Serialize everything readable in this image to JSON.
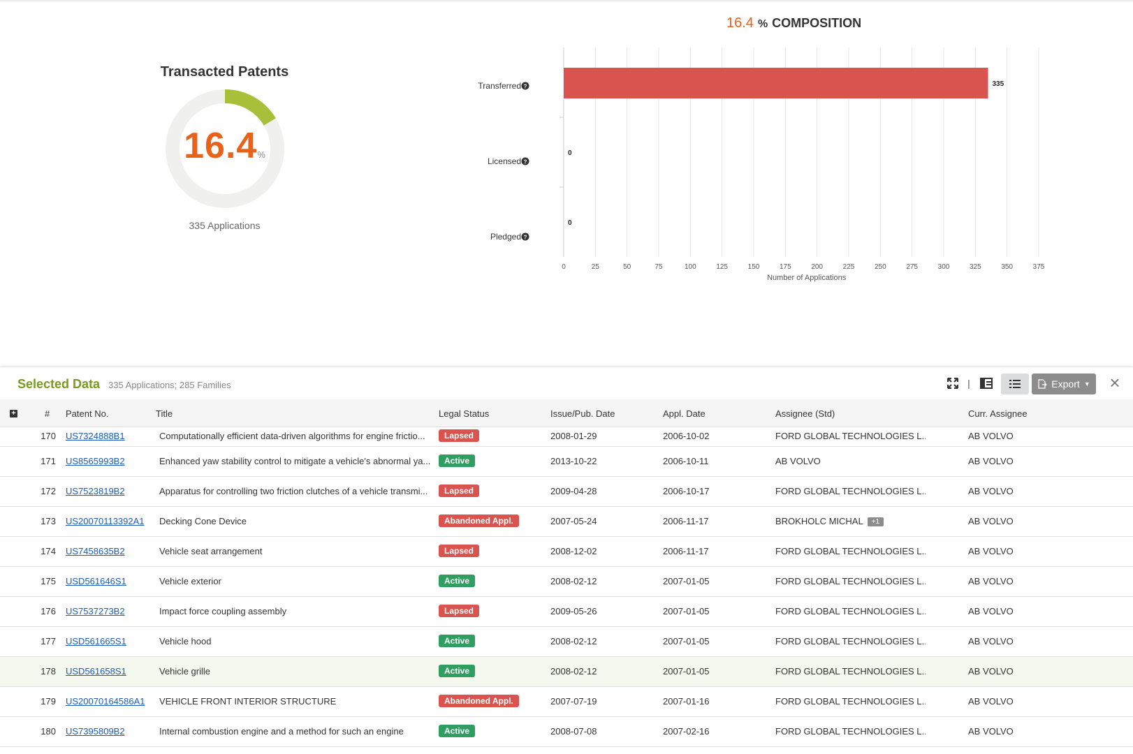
{
  "donut": {
    "title": "Transacted Patents",
    "value": "16.4",
    "unit": "%",
    "fraction": 0.164,
    "subtitle": "335 Applications",
    "colors": {
      "fill": "#a8bf3a",
      "track": "#f0f0ee",
      "value": "#e8621a"
    }
  },
  "composition": {
    "pct": "16.4",
    "pct_sign": "%",
    "title": "COMPOSITION"
  },
  "chart_data": {
    "type": "bar",
    "orientation": "horizontal",
    "categories": [
      "Transferred",
      "Licensed",
      "Pledged"
    ],
    "values": [
      335,
      0,
      0
    ],
    "value_labels": [
      "335",
      "0",
      "0"
    ],
    "xlabel": "Number of Applications",
    "xlim": [
      0,
      375
    ],
    "xticks": [
      "0",
      "25",
      "50",
      "75",
      "100",
      "125",
      "150",
      "175",
      "200",
      "225",
      "250",
      "275",
      "300",
      "325",
      "350",
      "375"
    ],
    "grid": true,
    "bar_color": "#d9534f",
    "help_icon": "question-circle-icon"
  },
  "panel": {
    "title": "Selected Data",
    "summary": "335 Applications; 285 Families",
    "separator": "|",
    "export_label": "Export",
    "close_glyph": "×"
  },
  "columns": {
    "num": "#",
    "patent": "Patent No.",
    "title": "Title",
    "status": "Legal Status",
    "issue": "Issue/Pub. Date",
    "appl": "Appl. Date",
    "assignee": "Assignee (Std)",
    "current": "Curr. Assignee"
  },
  "rows": [
    {
      "num": "170",
      "patent": "US7324888B1",
      "title": "Computationally efficient data-driven algorithms for engine frictio...",
      "status": "Lapsed",
      "status_type": "lapsed",
      "issue": "2008-01-29",
      "appl": "2006-10-02",
      "assignee": "FORD GLOBAL TECHNOLOGIES L...",
      "extra": "",
      "current": "AB VOLVO"
    },
    {
      "num": "171",
      "patent": "US8565993B2",
      "title": "Enhanced yaw stability control to mitigate a vehicle's abnormal ya...",
      "status": "Active",
      "status_type": "active",
      "issue": "2013-10-22",
      "appl": "2006-10-11",
      "assignee": "AB VOLVO",
      "extra": "",
      "current": "AB VOLVO"
    },
    {
      "num": "172",
      "patent": "US7523819B2",
      "title": "Apparatus for controlling two friction clutches of a vehicle transmi...",
      "status": "Lapsed",
      "status_type": "lapsed",
      "issue": "2009-04-28",
      "appl": "2006-10-17",
      "assignee": "FORD GLOBAL TECHNOLOGIES L...",
      "extra": "",
      "current": "AB VOLVO"
    },
    {
      "num": "173",
      "patent": "US20070113392A1",
      "title": "Decking Cone Device",
      "status": "Abandoned Appl.",
      "status_type": "abandoned",
      "issue": "2007-05-24",
      "appl": "2006-11-17",
      "assignee": "BROKHOLC MICHAL",
      "extra": "+1",
      "current": "AB VOLVO"
    },
    {
      "num": "174",
      "patent": "US7458635B2",
      "title": "Vehicle seat arrangement",
      "status": "Lapsed",
      "status_type": "lapsed",
      "issue": "2008-12-02",
      "appl": "2006-11-17",
      "assignee": "FORD GLOBAL TECHNOLOGIES L...",
      "extra": "",
      "current": "AB VOLVO"
    },
    {
      "num": "175",
      "patent": "USD561646S1",
      "title": "Vehicle exterior",
      "status": "Active",
      "status_type": "active",
      "issue": "2008-02-12",
      "appl": "2007-01-05",
      "assignee": "FORD GLOBAL TECHNOLOGIES L...",
      "extra": "",
      "current": "AB VOLVO"
    },
    {
      "num": "176",
      "patent": "US7537273B2",
      "title": "Impact force coupling assembly",
      "status": "Lapsed",
      "status_type": "lapsed",
      "issue": "2009-05-26",
      "appl": "2007-01-05",
      "assignee": "FORD GLOBAL TECHNOLOGIES L...",
      "extra": "",
      "current": "AB VOLVO"
    },
    {
      "num": "177",
      "patent": "USD561665S1",
      "title": "Vehicle hood",
      "status": "Active",
      "status_type": "active",
      "issue": "2008-02-12",
      "appl": "2007-01-05",
      "assignee": "FORD GLOBAL TECHNOLOGIES L...",
      "extra": "",
      "current": "AB VOLVO"
    },
    {
      "num": "178",
      "patent": "USD561658S1",
      "title": "Vehicle grille",
      "status": "Active",
      "status_type": "active",
      "issue": "2008-02-12",
      "appl": "2007-01-05",
      "assignee": "FORD GLOBAL TECHNOLOGIES L...",
      "extra": "",
      "current": "AB VOLVO",
      "highlight": true
    },
    {
      "num": "179",
      "patent": "US20070164586A1",
      "title": "VEHICLE FRONT INTERIOR STRUCTURE",
      "status": "Abandoned Appl.",
      "status_type": "abandoned",
      "issue": "2007-07-19",
      "appl": "2007-01-16",
      "assignee": "FORD GLOBAL TECHNOLOGIES L...",
      "extra": "",
      "current": "AB VOLVO"
    },
    {
      "num": "180",
      "patent": "US7395809B2",
      "title": "Internal combustion engine and a method for such an engine",
      "status": "Active",
      "status_type": "active",
      "issue": "2008-07-08",
      "appl": "2007-02-16",
      "assignee": "FORD GLOBAL TECHNOLOGIES L...",
      "extra": "",
      "current": "AB VOLVO"
    }
  ]
}
